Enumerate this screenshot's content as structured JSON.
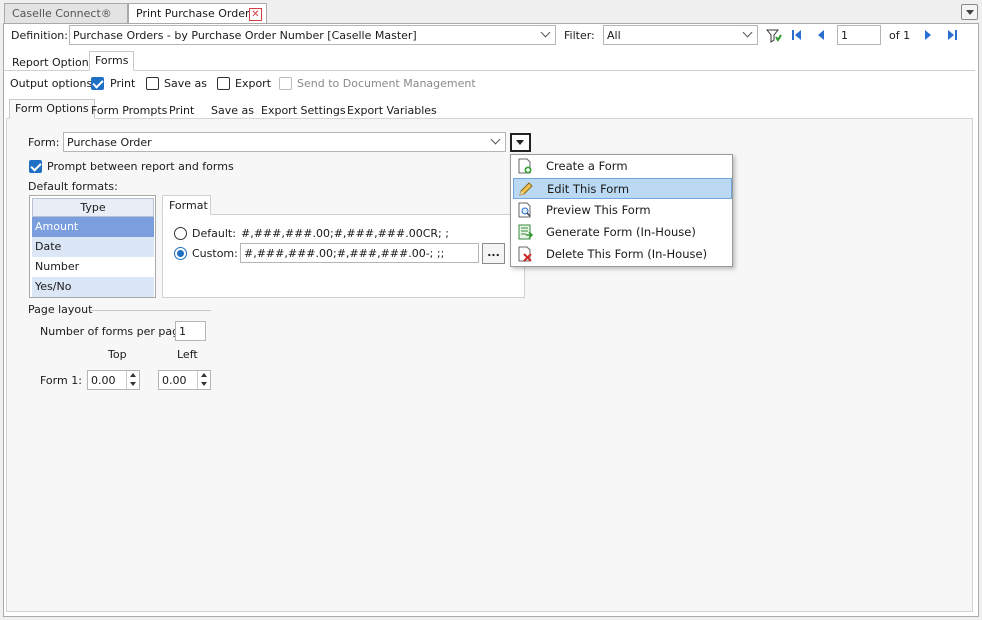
{
  "tabs": [
    {
      "label": "Caselle Connect®"
    },
    {
      "label": "Print Purchase Orders"
    }
  ],
  "toolbar": {
    "definition_label": "Definition:",
    "definition_value": "Purchase Orders - by Purchase Order Number [Caselle Master]",
    "filter_label": "Filter:",
    "filter_value": "All",
    "page_value": "1",
    "page_of": "of 1"
  },
  "section_tabs": [
    "Report Options",
    "Forms"
  ],
  "output_options": {
    "label": "Output options:",
    "print": "Print",
    "save_as": "Save as",
    "export": "Export",
    "send_doc": "Send to Document Management"
  },
  "form_tabs": [
    "Form Options",
    "Form Prompts",
    "Print",
    "Save as",
    "Export Settings",
    "Export Variables"
  ],
  "form": {
    "label": "Form:",
    "value": "Purchase Order",
    "prompt_label": "Prompt between report and forms",
    "default_formats_label": "Default formats:"
  },
  "type_grid": {
    "header": "Type",
    "rows": [
      "Amount",
      "Date",
      "Number",
      "Yes/No"
    ]
  },
  "format_panel": {
    "tab": "Format",
    "default_label": "Default:",
    "default_value": "#,###,###.00;#,###,###.00CR; ;",
    "custom_label": "Custom:",
    "custom_value": "#,###,###.00;#,###,###.00-; ;;",
    "ellipsis": "..."
  },
  "page_layout": {
    "label": "Page layout",
    "forms_per_page_label": "Number of forms per page:",
    "forms_per_page_value": "1",
    "top_label": "Top",
    "left_label": "Left",
    "form1_label": "Form 1:",
    "top_value": "0.00",
    "left_value": "0.00"
  },
  "dropdown_menu": {
    "items": [
      {
        "label": "Create a Form",
        "icon": "create-form-icon"
      },
      {
        "label": "Edit This Form",
        "icon": "pencil-icon"
      },
      {
        "label": "Preview This Form",
        "icon": "preview-icon"
      },
      {
        "label": "Generate Form (In-House)",
        "icon": "generate-icon"
      },
      {
        "label": "Delete This Form (In-House)",
        "icon": "delete-icon"
      }
    ]
  },
  "colors": {
    "selection": "#7b9fde",
    "menu_highlight": "#bcd9f4",
    "accent": "#1f6fc4"
  }
}
